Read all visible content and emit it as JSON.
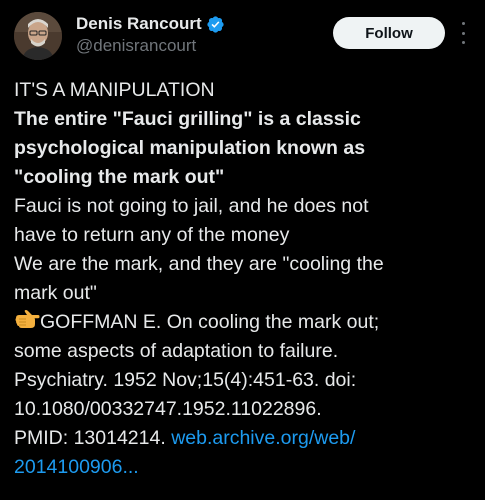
{
  "author": {
    "display_name": "Denis Rancourt",
    "handle": "@denisrancourt",
    "verified": true,
    "avatar": "avatar-photo"
  },
  "actions": {
    "follow_label": "Follow",
    "more_icon": "more-vertical-icon"
  },
  "tweet": {
    "lines": [
      "IT'S A MANIPULATION",
      "The entire \"Fauci grilling\" is a classic",
      "psychological manipulation known as",
      "\"cooling the mark out\"",
      "Fauci is not going to jail, and he does not",
      "have to return any of the money",
      "We are the mark, and they are \"cooling the",
      "mark out\"",
      "GOFFMAN E. On cooling the mark out;",
      "some aspects of adaptation to failure.",
      "Psychiatry. 1952 Nov;15(4):451-63. doi:",
      "10.1080/00332747.1952.11022896.",
      "PMID: 13014214. "
    ],
    "link_part1": "web.archive.org/web/",
    "link_part2": "2014100906..."
  },
  "colors": {
    "background": "#000000",
    "text": "#e7e9ea",
    "secondary": "#71767b",
    "link": "#1d9bf0",
    "verified": "#1d9bf0",
    "follow_bg": "#eff3f4"
  }
}
